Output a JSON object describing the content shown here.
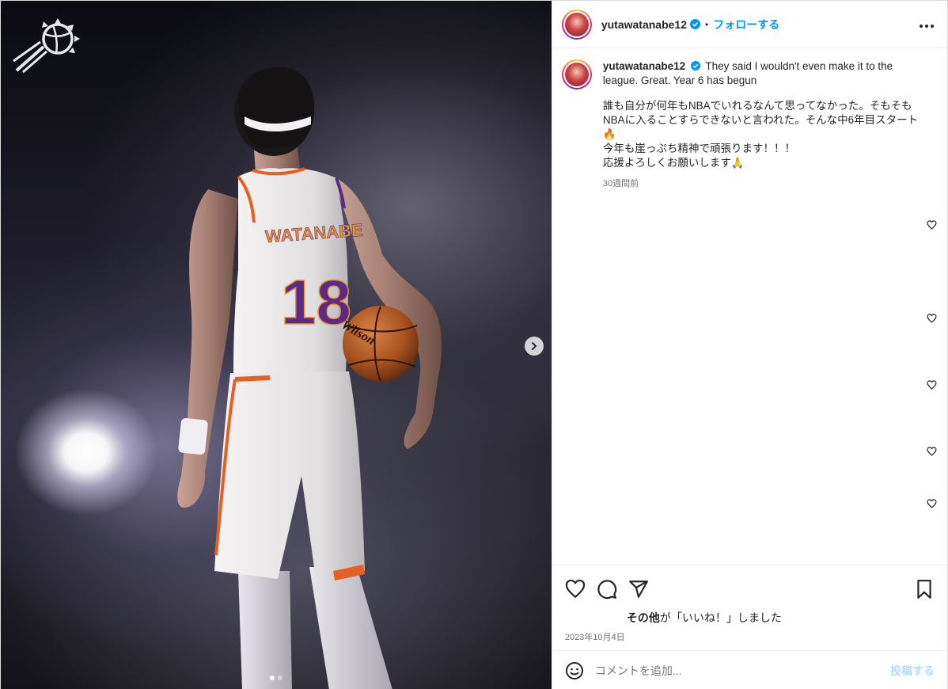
{
  "post": {
    "username": "yutawatanabe12",
    "separator": "•",
    "follow_label": "フォローする",
    "more_icon": "more-horizontal-icon",
    "caption_en": "They said I wouldn't even make it to the league. Great. Year 6 has begun",
    "caption_jp": [
      "誰も自分が何年もNBAでいれるなんて思ってなかった。そもそもNBAに入ることすらできないと言われた。そんな中6年目スタート🔥",
      "今年も崖っぷち精神で頑張ります！！！",
      "応援よろしくお願いします🙏"
    ],
    "caption_time": "30週間前",
    "likes_suffix": "その他が「いいね！」しました",
    "likes_bold": "その他",
    "date": "2023年10月4日",
    "comment_placeholder": "コメントを追加...",
    "post_label": "投稿する"
  },
  "media": {
    "jersey_name": "WATANABE",
    "jersey_number": "18",
    "ball_text": "Wilson",
    "carousel_count": 2,
    "carousel_active": 1
  },
  "colors": {
    "accent": "#0095f6",
    "purple": "#5b2a86",
    "orange": "#e56020"
  }
}
